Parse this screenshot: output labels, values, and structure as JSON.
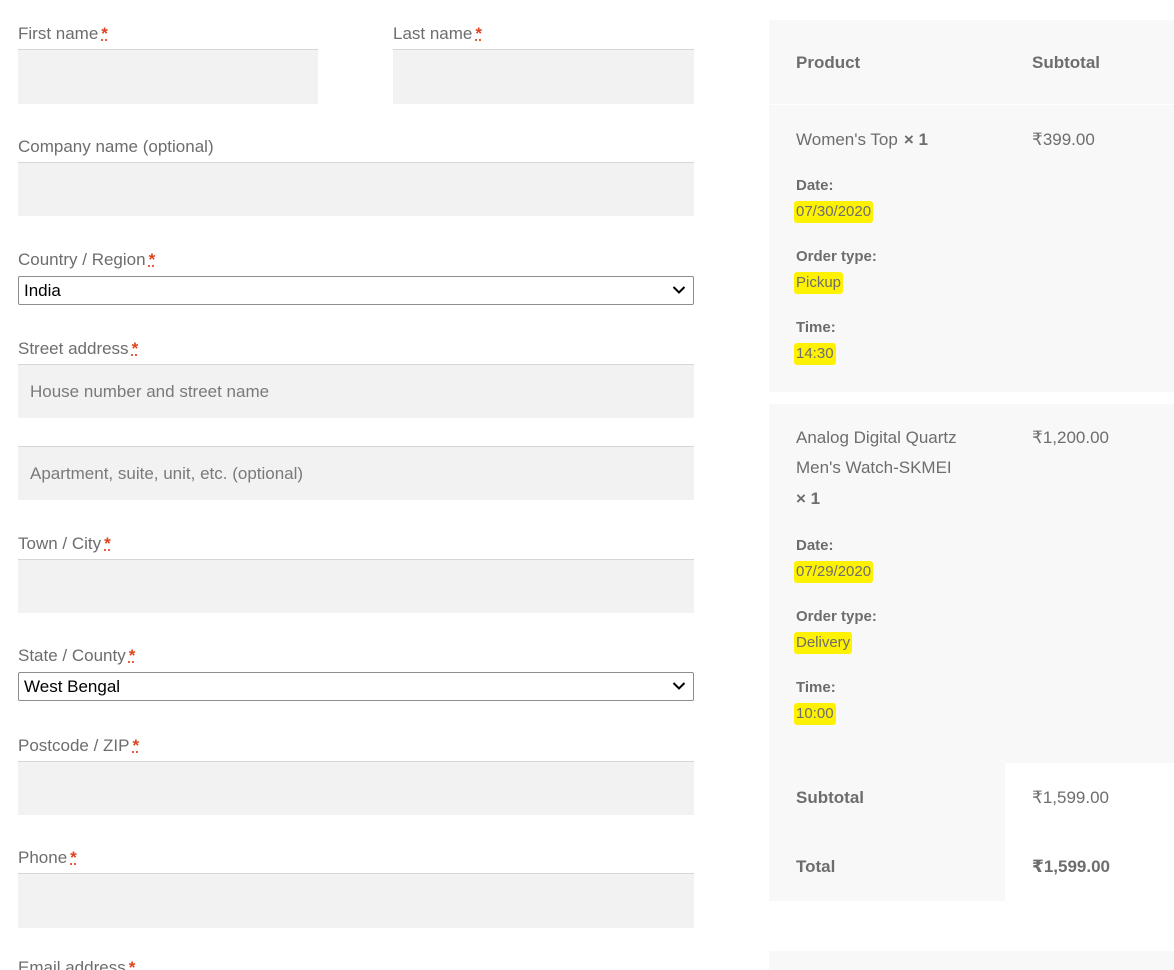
{
  "form": {
    "required_mark": "*",
    "first_name": {
      "label": "First name",
      "value": ""
    },
    "last_name": {
      "label": "Last name",
      "value": ""
    },
    "company": {
      "label": "Company name (optional)",
      "value": ""
    },
    "country": {
      "label": "Country / Region",
      "value": "India"
    },
    "street": {
      "label": "Street address",
      "placeholder_1": "House number and street name",
      "placeholder_2": "Apartment, suite, unit, etc. (optional)"
    },
    "city": {
      "label": "Town / City",
      "value": ""
    },
    "state": {
      "label": "State / County",
      "value": "West Bengal"
    },
    "postcode": {
      "label": "Postcode / ZIP",
      "value": ""
    },
    "phone": {
      "label": "Phone",
      "value": ""
    },
    "email": {
      "label": "Email address"
    }
  },
  "order": {
    "headers": {
      "product": "Product",
      "subtotal": "Subtotal"
    },
    "items": [
      {
        "name": "Women's Top",
        "qty": "× 1",
        "price": "₹399.00",
        "date_label": "Date:",
        "date": "07/30/2020",
        "type_label": "Order type:",
        "type": "Pickup",
        "time_label": "Time:",
        "time": "14:30"
      },
      {
        "name_line1": "Analog Digital Quartz",
        "name_line2": "Men's Watch-SKMEI",
        "qty": "× 1",
        "price": "₹1,200.00",
        "date_label": "Date:",
        "date": "07/29/2020",
        "type_label": "Order type:",
        "type": "Delivery",
        "time_label": "Time:",
        "time": "10:00"
      }
    ],
    "subtotal": {
      "label": "Subtotal",
      "value": "₹1,599.00"
    },
    "total": {
      "label": "Total",
      "value": "₹1,599.00"
    }
  },
  "colors": {
    "required": "#e2401c",
    "highlight": "#fff200",
    "input_bg": "#f2f2f2",
    "panel_bg": "#f8f8f8"
  }
}
